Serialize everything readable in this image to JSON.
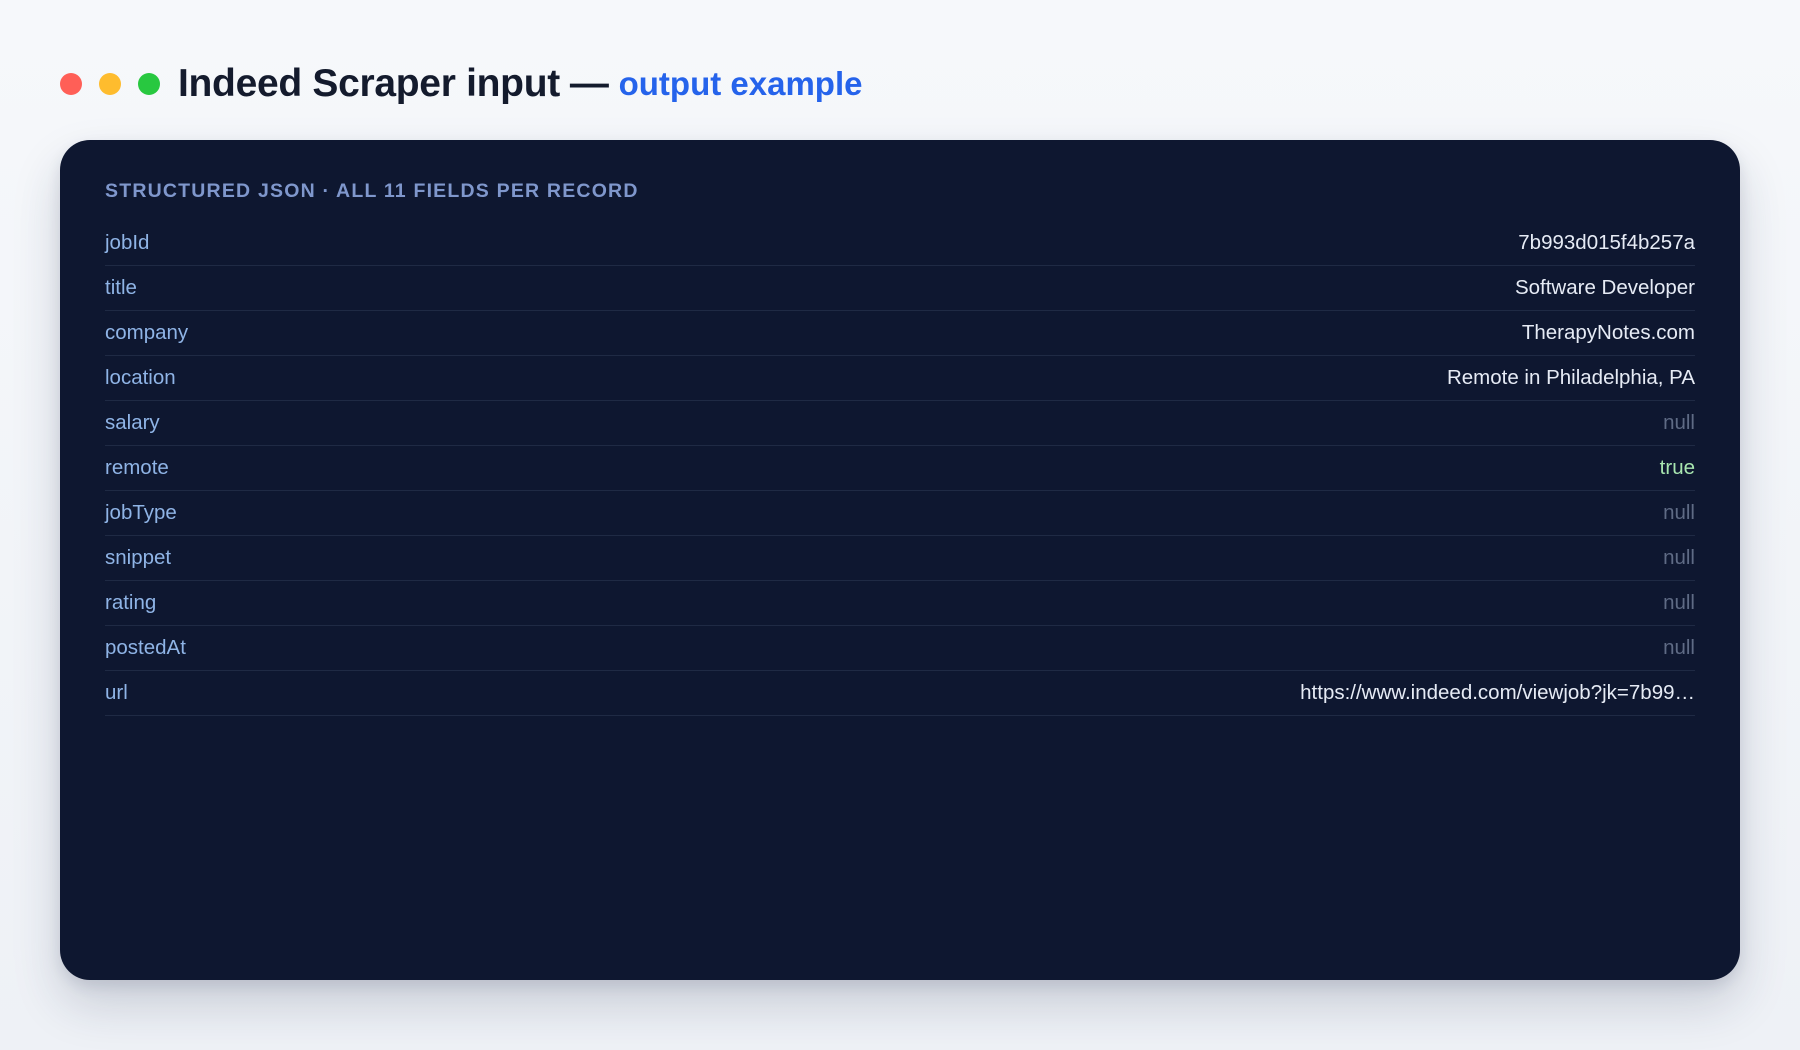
{
  "header": {
    "title": "Indeed Scraper input",
    "dash": "—",
    "subtitle": "output example"
  },
  "panel": {
    "heading": "STRUCTURED JSON · ALL 11 FIELDS PER RECORD",
    "fields": [
      {
        "key": "jobId",
        "value": "7b993d015f4b257a",
        "kind": "string"
      },
      {
        "key": "title",
        "value": "Software Developer",
        "kind": "string"
      },
      {
        "key": "company",
        "value": "TherapyNotes.com",
        "kind": "string"
      },
      {
        "key": "location",
        "value": "Remote in Philadelphia, PA",
        "kind": "string"
      },
      {
        "key": "salary",
        "value": "null",
        "kind": "null"
      },
      {
        "key": "remote",
        "value": "true",
        "kind": "bool"
      },
      {
        "key": "jobType",
        "value": "null",
        "kind": "null"
      },
      {
        "key": "snippet",
        "value": "null",
        "kind": "null"
      },
      {
        "key": "rating",
        "value": "null",
        "kind": "null"
      },
      {
        "key": "postedAt",
        "value": "null",
        "kind": "null"
      },
      {
        "key": "url",
        "value": "https://www.indeed.com/viewjob?jk=7b99…",
        "kind": "string"
      }
    ]
  },
  "colors": {
    "window_close": "#ff5f57",
    "window_minimize": "#febc2e",
    "window_zoom": "#28c840",
    "accent": "#2563eb",
    "panel_bg": "#0e1730"
  }
}
